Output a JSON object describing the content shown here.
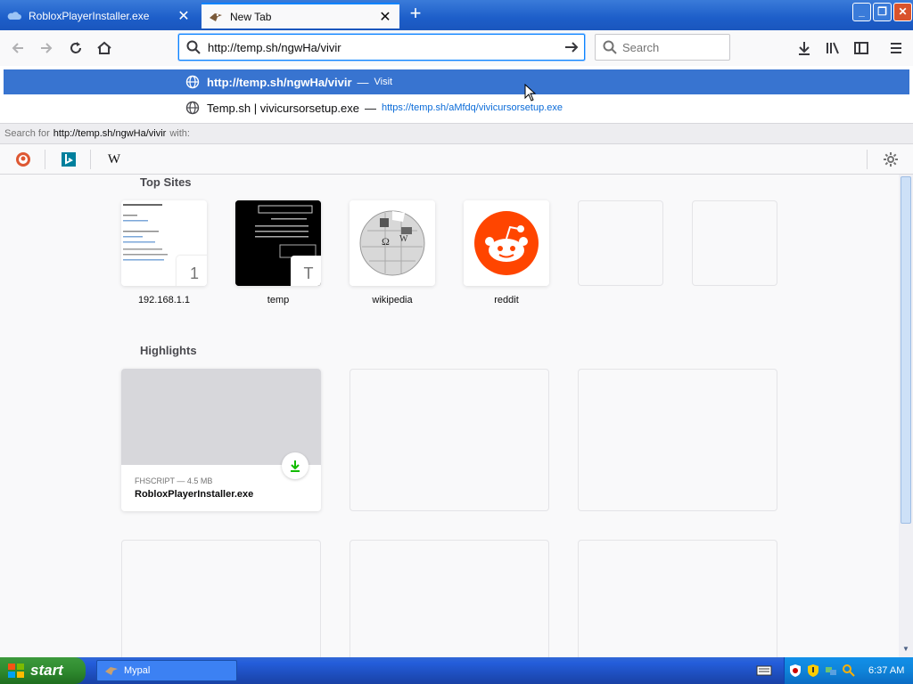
{
  "tabs": [
    {
      "label": "RobloxPlayerInstaller.exe"
    },
    {
      "label": "New Tab"
    }
  ],
  "urlbar": {
    "value": "http://temp.sh/ngwHa/vivir"
  },
  "searchbox": {
    "placeholder": "Search"
  },
  "popup": {
    "row1": {
      "url": "http://temp.sh/ngwHa/vivir",
      "sep": "—",
      "action": "Visit"
    },
    "row2": {
      "title": "Temp.sh | vivicursorsetup.exe",
      "sep": "—",
      "url": "https://temp.sh/aMfdq/vivicursorsetup.exe"
    },
    "search_for": {
      "prefix": "Search for",
      "query": "http://temp.sh/ngwHa/vivir",
      "suffix": "with:"
    }
  },
  "top_sites": {
    "title": "Top Sites",
    "items": [
      {
        "name": "192.168.1.1",
        "letter": "1"
      },
      {
        "name": "temp",
        "letter": "T"
      },
      {
        "name": "wikipedia"
      },
      {
        "name": "reddit"
      }
    ]
  },
  "highlights": {
    "title": "Highlights",
    "card": {
      "meta": "FHSCRIPT — 4.5 MB",
      "title": "RobloxPlayerInstaller.exe"
    }
  },
  "taskbar": {
    "start": "start",
    "task": "Mypal",
    "clock": "6:37 AM"
  },
  "colors": {
    "accent": "#0a84ff",
    "selected_row": "#3874d0",
    "reddit": "#ff4500",
    "download": "#12bc00"
  }
}
